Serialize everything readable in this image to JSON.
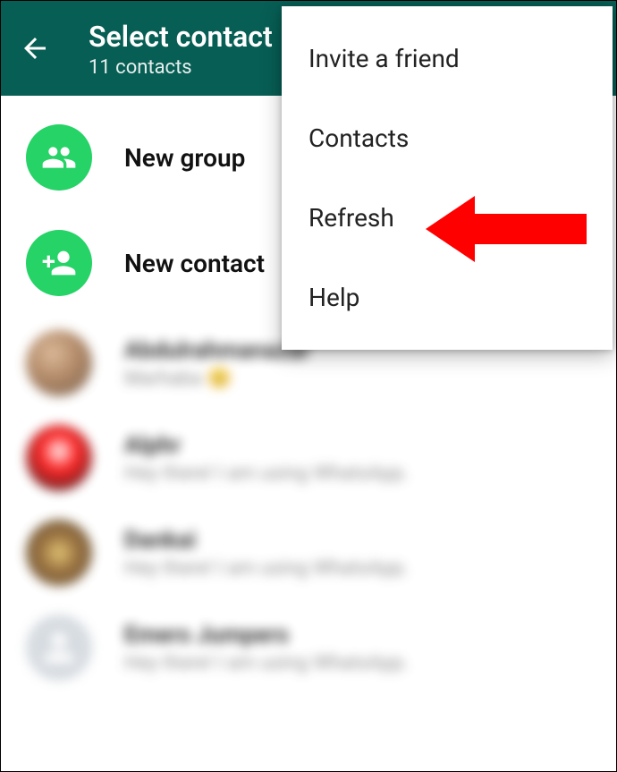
{
  "header": {
    "title": "Select contact",
    "subtitle": "11 contacts"
  },
  "actions": {
    "newGroup": "New group",
    "newContact": "New contact"
  },
  "menu": {
    "invite": "Invite a friend",
    "contacts": "Contacts",
    "refresh": "Refresh",
    "help": "Help"
  },
  "contacts": [
    {
      "name": "Abdulrahmanazar",
      "status": "Marhaba 😊"
    },
    {
      "name": "Alphr",
      "status": "Hey there! I am using WhatsApp."
    },
    {
      "name": "Dankai",
      "status": "Hey there! I am using WhatsApp."
    },
    {
      "name": "Emers Jumpers",
      "status": "Hey there! I am using WhatsApp."
    }
  ]
}
